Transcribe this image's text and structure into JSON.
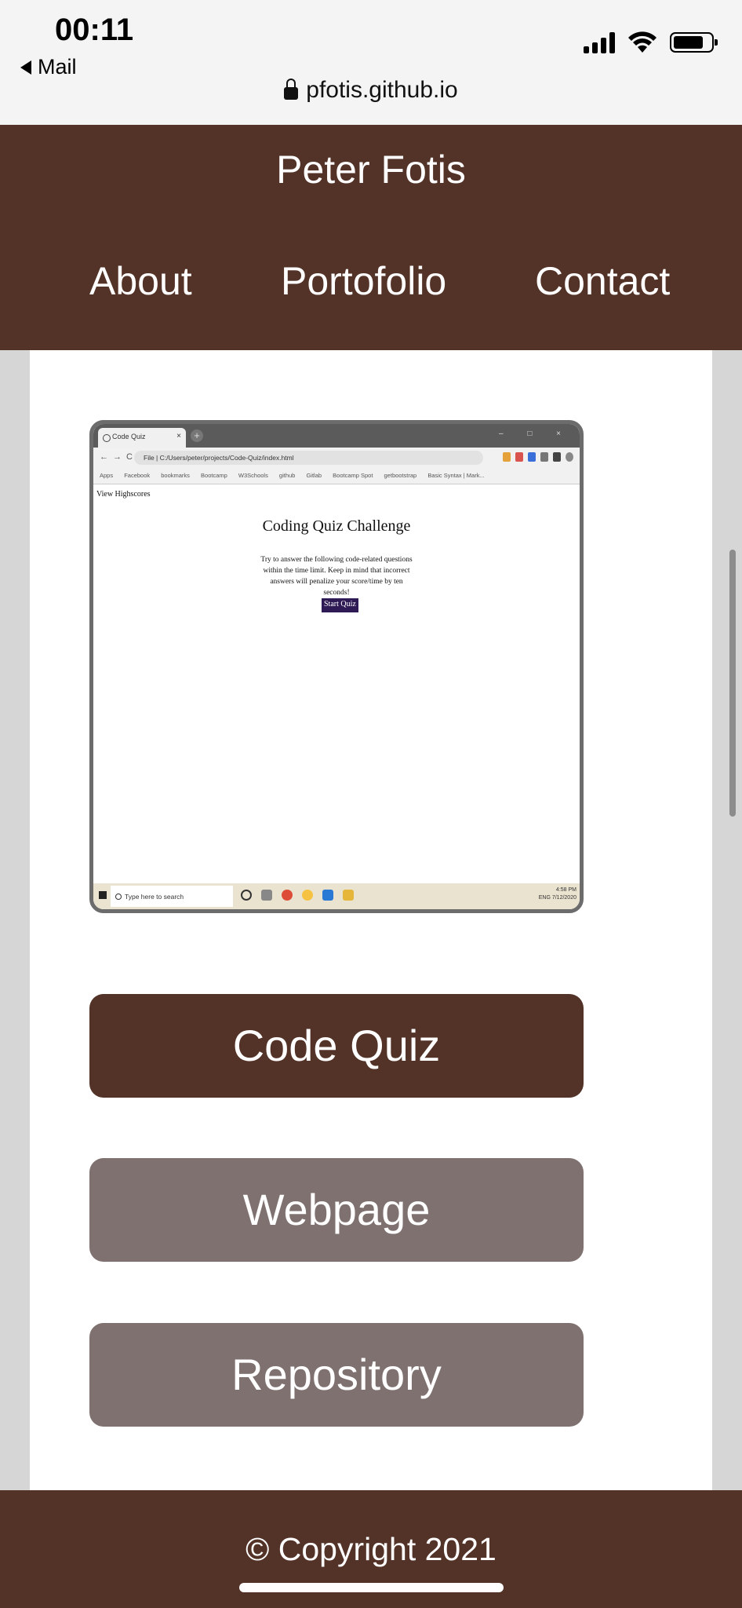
{
  "status_bar": {
    "time": "00:11",
    "back_label": "Mail",
    "url": "pfotis.github.io"
  },
  "header": {
    "title": "Peter Fotis",
    "nav": [
      "About",
      "Portofolio",
      "Contact"
    ]
  },
  "project": {
    "screenshot": {
      "tab_title": "Code Quiz",
      "address": "File | C:/Users/peter/projects/Code-Quiz/index.html",
      "bookmarks": [
        "Apps",
        "Facebook",
        "bookmarks",
        "Bootcamp",
        "W3Schools",
        "github",
        "Gitlab",
        "Bootcamp Spot",
        "getbootstrap",
        "Basic Syntax | Mark..."
      ],
      "view_highscores": "View Highscores",
      "quiz_title": "Coding Quiz Challenge",
      "description": "Try to answer the following code-related questions within the time limit. Keep in mind that incorrect answers will penalize your score/time by ten seconds!",
      "start_button": "Start Quiz",
      "taskbar_search": "Type here to search",
      "tray_time": "4:58 PM",
      "tray_date": "7/12/2020",
      "tray_lang": "ENG"
    },
    "buttons": {
      "primary": "Code Quiz",
      "webpage": "Webpage",
      "repository": "Repository"
    }
  },
  "footer": {
    "copyright": "© Copyright 2021"
  },
  "colors": {
    "brand_brown": "#533227",
    "button_gray": "#7f7170",
    "page_bg": "#d6d6d6"
  }
}
